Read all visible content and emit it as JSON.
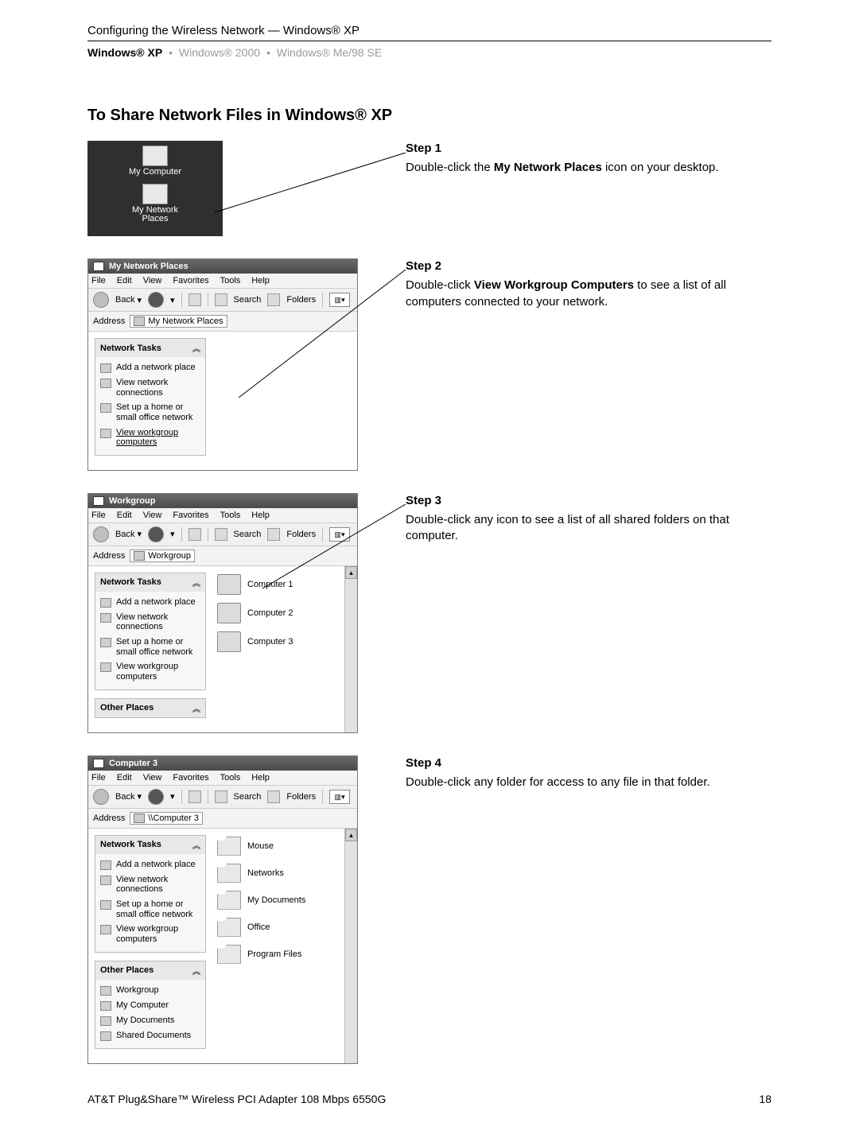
{
  "header": {
    "breadcrumb": "Configuring the Wireless Network — Windows® XP",
    "tabs": {
      "active": "Windows® XP",
      "inactive1": "Windows® 2000",
      "inactive2": "Windows® Me/98 SE",
      "bullet": "•"
    }
  },
  "title": "To Share Network Files in Windows® XP",
  "steps": {
    "s1": {
      "heading": "Step 1",
      "text_before": "Double-click the ",
      "bold": "My Network Places",
      "text_after": " icon on your desktop."
    },
    "s2": {
      "heading": "Step 2",
      "text_before": "Double-click ",
      "bold": "View Workgroup Computers",
      "text_after": " to see a list of all computers connected to your network."
    },
    "s3": {
      "heading": "Step 3",
      "text": "Double-click any icon to see a list of all shared folders on that computer."
    },
    "s4": {
      "heading": "Step 4",
      "text": "Double-click any folder for access to any file in that folder."
    }
  },
  "desktop": {
    "icon1": "My Computer",
    "icon2_l1": "My Network",
    "icon2_l2": "Places"
  },
  "menus": {
    "file": "File",
    "edit": "Edit",
    "view": "View",
    "favorites": "Favorites",
    "tools": "Tools",
    "help": "Help"
  },
  "toolbar": {
    "back": "Back",
    "search": "Search",
    "folders": "Folders",
    "views_glyph": "▥",
    "dd": "▾"
  },
  "address_label": "Address",
  "win1": {
    "title": "My Network Places",
    "addr": "My Network Places",
    "tasks_title": "Network Tasks",
    "t1": "Add a network place",
    "t2": "View network connections",
    "t3": "Set up a home or small office network",
    "t4": "View workgroup computers"
  },
  "win2": {
    "title": "Workgroup",
    "addr": "Workgroup",
    "tasks_title": "Network Tasks",
    "t1": "Add a network place",
    "t2": "View network connections",
    "t3": "Set up a home or small office network",
    "t4": "View workgroup computers",
    "c1": "Computer 1",
    "c2": "Computer 2",
    "c3": "Computer 3",
    "other_title": "Other Places"
  },
  "win3": {
    "title": "Computer 3",
    "addr": "\\\\Computer 3",
    "tasks_title": "Network Tasks",
    "t1": "Add a network place",
    "t2": "View network connections",
    "t3": "Set up a home or small office network",
    "t4": "View workgroup computers",
    "other_title": "Other Places",
    "o1": "Workgroup",
    "o2": "My Computer",
    "o3": "My Documents",
    "o4": "Shared Documents",
    "f1": "Mouse",
    "f2": "Networks",
    "f3": "My Documents",
    "f4": "Office",
    "f5": "Program Files"
  },
  "footer": {
    "left": "AT&T Plug&Share™ Wireless PCI Adapter 108 Mbps 6550G",
    "right": "18"
  }
}
